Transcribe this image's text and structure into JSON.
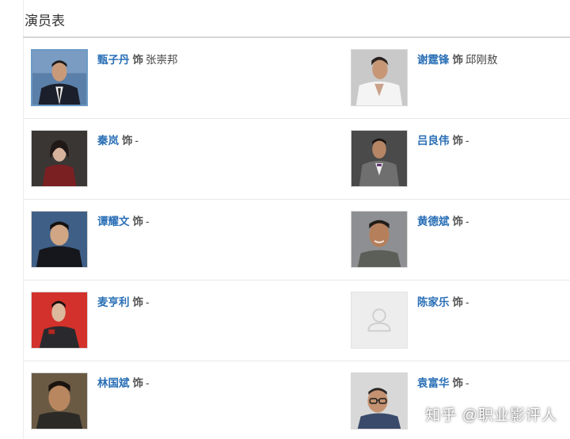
{
  "section": {
    "title": "演员表"
  },
  "cast": [
    {
      "actor": "甄子丹",
      "as": "饰",
      "role": "张崇邦",
      "photo": "man-in-suit-portrait"
    },
    {
      "actor": "谢霆锋",
      "as": "饰",
      "role": "邱刚敖",
      "photo": "man-white-shirt-portrait"
    },
    {
      "actor": "秦岚",
      "as": "饰",
      "role": "-",
      "photo": "woman-red-dress-portrait"
    },
    {
      "actor": "吕良伟",
      "as": "饰",
      "role": "-",
      "photo": "man-grey-suit-portrait"
    },
    {
      "actor": "谭耀文",
      "as": "饰",
      "role": "-",
      "photo": "man-dark-jacket-portrait"
    },
    {
      "actor": "黄德斌",
      "as": "饰",
      "role": "-",
      "photo": "man-smiling-portrait"
    },
    {
      "actor": "麦亨利",
      "as": "饰",
      "role": "-",
      "photo": "man-red-background-portrait"
    },
    {
      "actor": "陈家乐",
      "as": "饰",
      "role": "-",
      "photo": "placeholder-avatar"
    },
    {
      "actor": "林国斌",
      "as": "饰",
      "role": "-",
      "photo": "man-close-up-portrait"
    },
    {
      "actor": "袁富华",
      "as": "饰",
      "role": "-",
      "photo": "man-glasses-portrait"
    }
  ],
  "watermark": "知乎 @职业影评人",
  "colors": {
    "link": "#2a6fb6",
    "rule": "#d6d6d6",
    "divider": "#e9e9e9"
  }
}
